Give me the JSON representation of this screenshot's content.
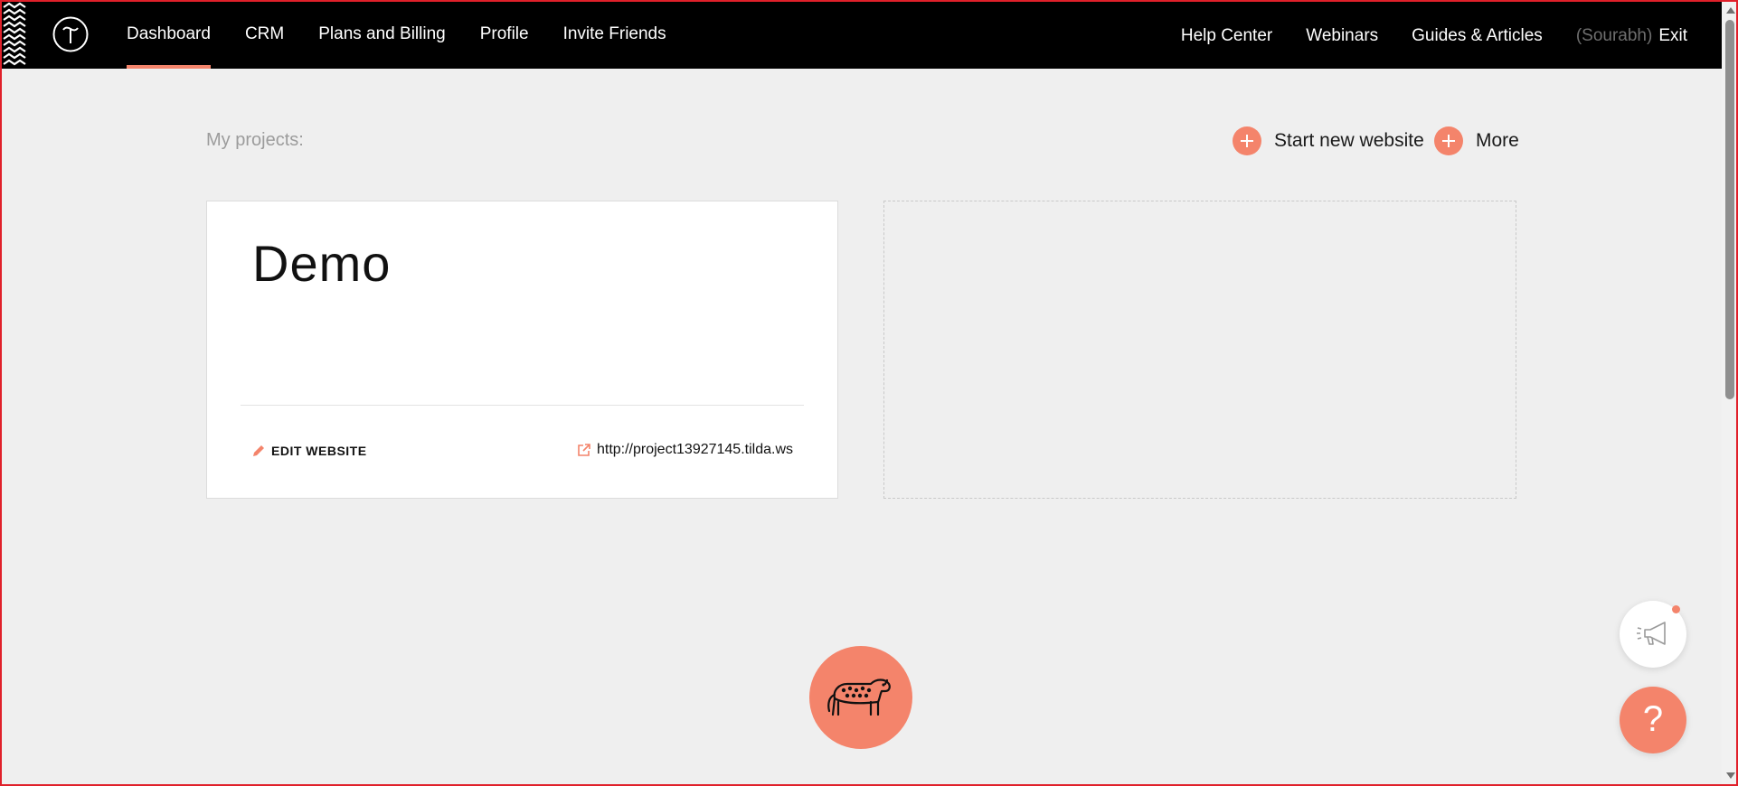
{
  "colors": {
    "accent": "#f4846b",
    "header_bg": "#000000",
    "page_bg": "#efefef"
  },
  "header": {
    "nav_left": [
      {
        "label": "Dashboard",
        "active": true
      },
      {
        "label": "CRM"
      },
      {
        "label": "Plans and Billing"
      },
      {
        "label": "Profile"
      },
      {
        "label": "Invite Friends"
      }
    ],
    "nav_right": [
      {
        "label": "Help Center"
      },
      {
        "label": "Webinars"
      },
      {
        "label": "Guides & Articles"
      }
    ],
    "user": "(Sourabh)",
    "exit": "Exit"
  },
  "projects": {
    "label": "My projects:",
    "start_new": "Start new website",
    "more": "More",
    "cards": [
      {
        "title": "Demo",
        "edit_label": "EDIT WEBSITE",
        "url": "http://project13927145.tilda.ws"
      }
    ]
  },
  "icons": {
    "logo": "tilda-logo-icon",
    "plus": "plus-circle-icon",
    "edit": "pencil-icon",
    "external": "external-link-icon",
    "mascot": "leopard-icon",
    "announce": "megaphone-icon",
    "help": "?"
  }
}
